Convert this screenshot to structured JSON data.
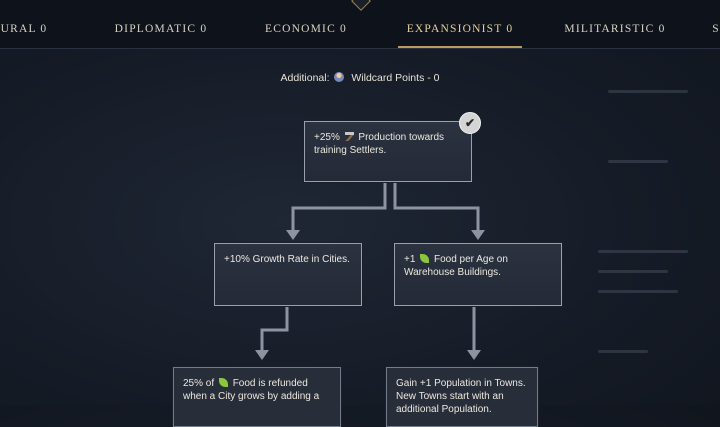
{
  "tabs": [
    {
      "label": "URAL 0",
      "active": false
    },
    {
      "label": "DIPLOMATIC 0",
      "active": false
    },
    {
      "label": "ECONOMIC 0",
      "active": false
    },
    {
      "label": "EXPANSIONIST 0",
      "active": true
    },
    {
      "label": "MILITARISTIC 0",
      "active": false
    },
    {
      "label": "S",
      "active": false
    }
  ],
  "additional": {
    "label": "Additional:",
    "icon": "wildcard-icon",
    "text": "Wildcard Points - 0"
  },
  "nodes": {
    "root": {
      "prefix": "+25%",
      "icon": "production-hammer-icon",
      "text": "Production towards training Settlers.",
      "unlocked": true
    },
    "left": {
      "text": "+10% Growth Rate in Cities."
    },
    "right": {
      "prefix": "+1",
      "icon": "food-leaf-icon",
      "text": "Food per Age on Warehouse Buildings."
    },
    "bottom_left": {
      "prefix": "25% of",
      "icon": "food-leaf-icon",
      "text": "Food is refunded when a City grows by adding a"
    },
    "bottom_right": {
      "text": "Gain +1 Population in Towns. New Towns start with an additional Population."
    }
  },
  "colors": {
    "accent_gold": "#b89b5e",
    "connector": "#8d93a0",
    "panel_border": "#9aa0ad"
  }
}
